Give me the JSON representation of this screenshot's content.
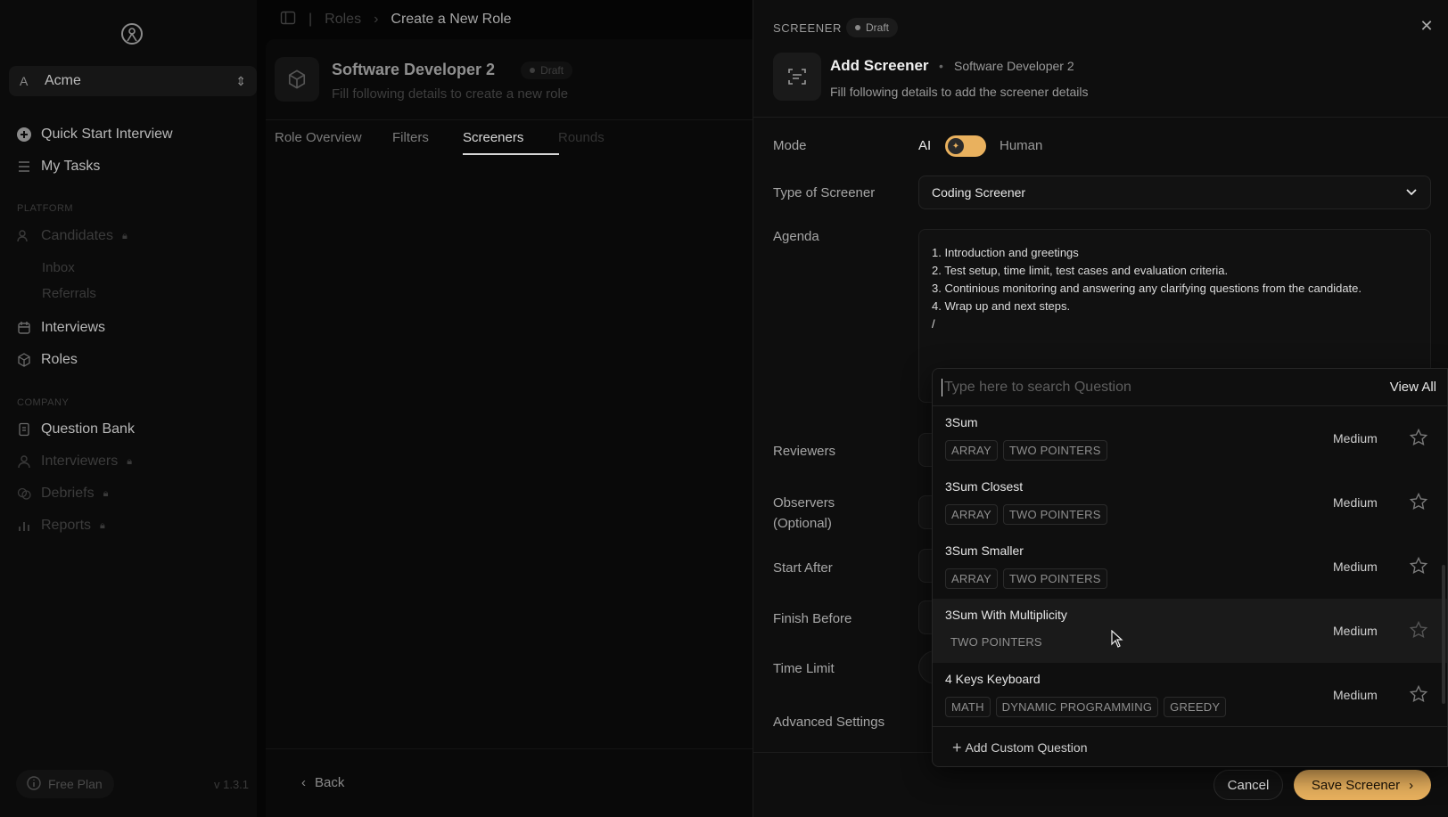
{
  "sidebar": {
    "workspace": {
      "letter": "A",
      "name": "Acme"
    },
    "items": [
      {
        "label": "Quick Start Interview",
        "icon": "plus-circle-icon"
      },
      {
        "label": "My Tasks",
        "icon": "list-icon"
      }
    ],
    "platform_section": "PLATFORM",
    "platform_items": [
      {
        "label": "Candidates",
        "icon": "users-icon",
        "locked": true
      },
      {
        "label": "Inbox"
      },
      {
        "label": "Referrals"
      },
      {
        "label": "Interviews",
        "icon": "calendar-icon"
      },
      {
        "label": "Roles",
        "icon": "cube-icon"
      }
    ],
    "company_section": "COMPANY",
    "company_items": [
      {
        "label": "Question Bank",
        "icon": "book-icon"
      },
      {
        "label": "Interviewers",
        "icon": "user-icon",
        "locked": true
      },
      {
        "label": "Debriefs",
        "icon": "chat-icon",
        "locked": true
      },
      {
        "label": "Reports",
        "icon": "bar-chart-icon",
        "locked": true
      }
    ],
    "plan": "Free Plan",
    "version": "v 1.3.1"
  },
  "breadcrumb": {
    "parent": "Roles",
    "current": "Create a New Role"
  },
  "role": {
    "title": "Software Developer 2",
    "status": "Draft",
    "subtitle": "Fill following details to create a new role",
    "tabs": [
      "Role Overview",
      "Filters",
      "Screeners",
      "Rounds"
    ],
    "active_tab": "Screeners",
    "back_label": "Back"
  },
  "drawer": {
    "label": "SCREENER",
    "status": "Draft",
    "title": "Add Screener",
    "role_name": "Software Developer 2",
    "subtitle": "Fill following details to add the screener details",
    "fields": {
      "mode": "Mode",
      "mode_ai": "AI",
      "mode_human": "Human",
      "type": "Type of Screener",
      "type_value": "Coding Screener",
      "agenda": "Agenda",
      "reviewers": "Reviewers",
      "observers": "Observers",
      "observers_optional": "(Optional)",
      "start_after": "Start After",
      "finish_before": "Finish Before",
      "time_limit": "Time Limit",
      "advanced": "Advanced Settings"
    },
    "agenda_lines": [
      "1. Introduction and greetings",
      "2. Test setup, time limit, test cases and evaluation criteria.",
      "3. Continious monitoring and answering any clarifying questions from the candidate.",
      "4. Wrap up and next steps.",
      "",
      "/"
    ],
    "cancel_label": "Cancel",
    "save_label": "Save Screener"
  },
  "question_search": {
    "placeholder": "Type here to search Question",
    "view_all": "View All",
    "questions": [
      {
        "name": "3Sum",
        "tags": [
          "ARRAY",
          "TWO POINTERS"
        ],
        "difficulty": "Medium"
      },
      {
        "name": "3Sum Closest",
        "tags": [
          "ARRAY",
          "TWO POINTERS"
        ],
        "difficulty": "Medium"
      },
      {
        "name": "3Sum Smaller",
        "tags": [
          "ARRAY",
          "TWO POINTERS"
        ],
        "difficulty": "Medium"
      },
      {
        "name": "3Sum With Multiplicity",
        "tags": [
          "TWO POINTERS"
        ],
        "difficulty": "Medium",
        "hovered": true
      },
      {
        "name": "4 Keys Keyboard",
        "tags": [
          "MATH",
          "DYNAMIC PROGRAMMING",
          "GREEDY"
        ],
        "difficulty": "Medium"
      }
    ],
    "add_custom": "Add Custom Question"
  },
  "colors": {
    "accent": "#e9b15e",
    "panel": "#0e0e0e",
    "backdrop": "#050505"
  }
}
